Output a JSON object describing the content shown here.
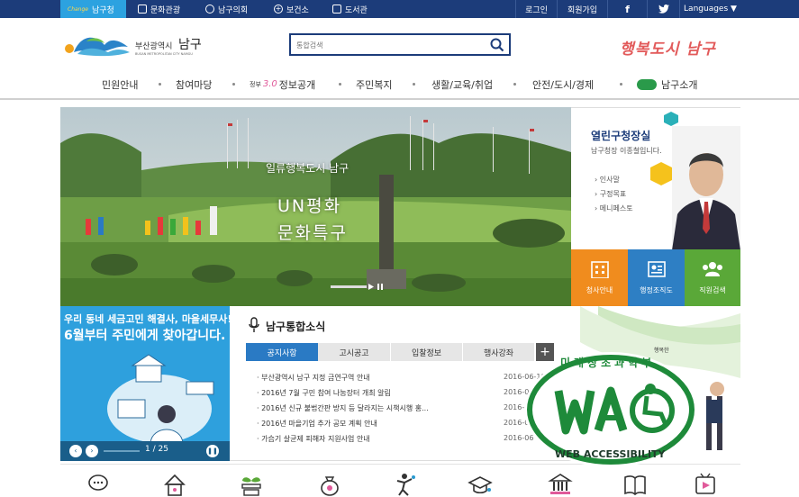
{
  "topbar": {
    "items": [
      {
        "label": "남구청",
        "icon": "namgu-logo-icon"
      },
      {
        "label": "문화관광",
        "icon": "culture-icon"
      },
      {
        "label": "남구의회",
        "icon": "council-icon"
      },
      {
        "label": "보건소",
        "icon": "health-icon"
      },
      {
        "label": "도서관",
        "icon": "library-icon"
      }
    ],
    "right": [
      "로그인",
      "회원가입",
      "f",
      "Languages ▼"
    ],
    "colors": {
      "bar": "#1c3c7a",
      "active": "#2ca2e0"
    }
  },
  "header": {
    "logo_text": "부산광역시",
    "logo_name": "남구",
    "logo_sub": "BUSAN METROPOLITAN CITY NAMGU",
    "search_placeholder": "통합검색",
    "slogan": "행복도시 남구"
  },
  "gnb": [
    "민원안내",
    "참여마당",
    "정보공개",
    "주민복지",
    "생활/교육/취업",
    "안전/도시/경제",
    "남구소개"
  ],
  "gnb_badge": {
    "prefix": "정부",
    "num": "3.0"
  },
  "hero": {
    "line1": "일류행복도시 남구",
    "line2": "UN평화",
    "line3": "문화특구"
  },
  "mayor": {
    "title": "열린구청장실",
    "subtitle": "남구청장 이종철입니다.",
    "links": [
      "인사말",
      "구정목표",
      "메니페스토"
    ]
  },
  "quick": [
    {
      "label": "청사안내",
      "color": "#f08c1e"
    },
    {
      "label": "행정조직도",
      "color": "#2e7fc4"
    },
    {
      "label": "직원검색",
      "color": "#5aa838"
    }
  ],
  "banner": {
    "line1": "우리 동네 세금고민 해결사, 마을세무사!",
    "line2": "6월부터 주민에게 찾아갑니다.",
    "page": "1 / 25"
  },
  "news": {
    "title": "남구통합소식",
    "tabs": [
      "공지사항",
      "고시공고",
      "입찰정보",
      "행사강좌"
    ],
    "more": "+",
    "rows": [
      {
        "title": "부산광역시 남구 지정 금연구역 안내",
        "date": "2016-06-10"
      },
      {
        "title": "2016년 7월 구민 참여 나눔장터 개최 알림",
        "date": "2016-06"
      },
      {
        "title": "2016년 신규 불법간판 방지 등 달라지는 시책시행 홍...",
        "date": "2016-06"
      },
      {
        "title": "2016년 마을기업 추가 공모 계획 안내",
        "date": "2016-06"
      },
      {
        "title": "가습기 살균제 피해자 지원사업 안내",
        "date": "2016-06"
      }
    ]
  },
  "promo": {
    "label": "행복한"
  },
  "wa": {
    "top": "미래창조과학부",
    "mark": "WA",
    "bottom": "WEB ACCESSIBILITY"
  },
  "bottom_icons": [
    "chat-icon",
    "house-icon",
    "sprout-icon",
    "money-bag-icon",
    "person-icon",
    "graduation-cap-icon",
    "bank-icon",
    "book-icon",
    "media-icon"
  ]
}
